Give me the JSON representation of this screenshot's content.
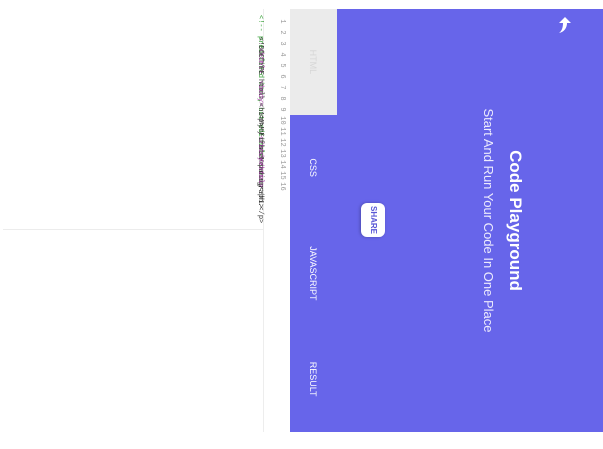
{
  "app": {
    "title": "Code Playground",
    "subtitle": "Start And Run Your Code In One Place",
    "share_label": "SHARE",
    "back_icon": "back-arrow-icon"
  },
  "colors": {
    "background": "#6765ea",
    "active_tab_bg": "#ebebeb",
    "comment": "#2f9c2f",
    "tag": "#a034a0"
  },
  "tabs": [
    {
      "label": "HTML",
      "active": true
    },
    {
      "label": "CSS",
      "active": false
    },
    {
      "label": "JAVASCRIPT",
      "active": false
    },
    {
      "label": "RESULT",
      "active": false
    }
  ],
  "editor": {
    "line_numbers": [
      "1",
      "2",
      "3",
      "4",
      "5",
      "6",
      "7",
      "8",
      "9",
      "10",
      "11",
      "12",
      "13",
      "14",
      "15",
      "16"
    ],
    "lines": [
      {
        "text": "<!-- predefined html, but editable -->",
        "kind": "comment"
      },
      {
        "text": "",
        "kind": "plain"
      },
      {
        "text": "<!DOCTYPE html>",
        "kind": "plain"
      },
      {
        "text": "<html>",
        "kind": "tag"
      },
      {
        "text": "",
        "kind": "plain"
      },
      {
        "text": "",
        "kind": "plain"
      },
      {
        "text": "<body>",
        "kind": "tag"
      },
      {
        "text": "",
        "kind": "plain"
      },
      {
        "text": "<h1>My First Heading</h1>",
        "kind": "plain"
      },
      {
        "text": "<p>My first paragraph.</p>",
        "kind": "plain"
      },
      {
        "text": "",
        "kind": "plain"
      },
      {
        "text": "</body>",
        "kind": "tag"
      },
      {
        "text": "",
        "kind": "plain"
      },
      {
        "text": "</html>",
        "kind": "tag"
      },
      {
        "text": "",
        "kind": "plain"
      },
      {
        "text": "",
        "kind": "plain"
      }
    ]
  }
}
